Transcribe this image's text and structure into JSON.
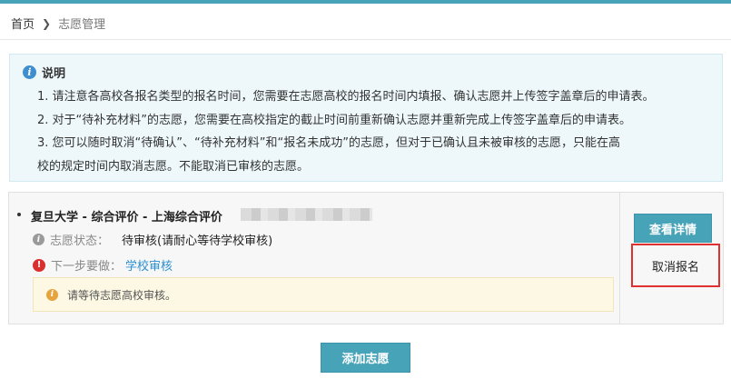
{
  "breadcrumb": {
    "home": "首页",
    "current": "志愿管理"
  },
  "notice": {
    "title": "说明",
    "lines": [
      "1. 请注意各高校各报名类型的报名时间，您需要在志愿高校的报名时间内填报、确认志愿并上传签字盖章后的申请表。",
      "2. 对于“待补充材料”的志愿，您需要在高校指定的截止时间前重新确认志愿并重新完成上传签字盖章后的申请表。",
      "3. 您可以随时取消“待确认”、“待补充材料”和“报名未成功”的志愿，但对于已确认且未被审核的志愿，只能在高",
      "校的规定时间内取消志愿。不能取消已审核的志愿。"
    ]
  },
  "application": {
    "school": "复旦大学 - 综合评价 - 上海综合评价",
    "status_label": "志愿状态：",
    "status_value": "待审核(请耐心等待学校审核)",
    "next_label": "下一步要做：",
    "next_link": "学校审核",
    "tip": "请等待志愿高校审核。",
    "detail_button": "查看详情",
    "cancel_button": "取消报名"
  },
  "actions": {
    "add_button": "添加志愿"
  },
  "colors": {
    "accent": "#47a3b8",
    "link": "#2a8fd0",
    "highlight_border": "#e03131"
  }
}
